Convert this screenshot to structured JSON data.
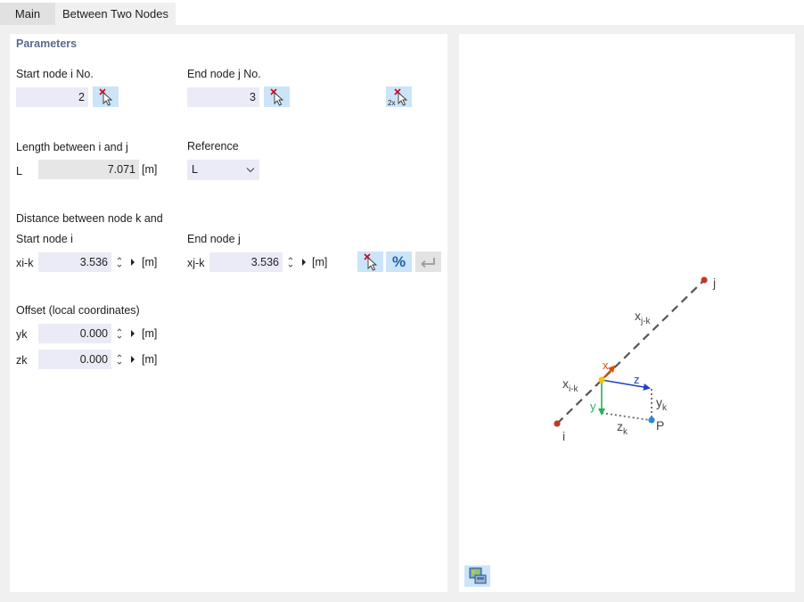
{
  "tabs": [
    {
      "label": "Main"
    },
    {
      "label": "Between Two Nodes"
    }
  ],
  "parameters": {
    "title": "Parameters",
    "start_node": {
      "label": "Start node i No.",
      "value": "2"
    },
    "end_node": {
      "label": "End node j No.",
      "value": "3"
    },
    "length": {
      "label": "Length between i and j",
      "symbol": "L",
      "value": "7.071",
      "unit": "[m]"
    },
    "reference": {
      "label": "Reference",
      "value": "L"
    },
    "distance": {
      "label": "Distance between node k and",
      "start_label": "Start node i",
      "end_label": "End node j",
      "xi_symbol": "xi-k",
      "xi_value": "3.536",
      "xj_symbol": "xj-k",
      "xj_value": "3.536",
      "unit": "[m]",
      "percent_label": "%"
    },
    "offset": {
      "label": "Offset (local coordinates)",
      "yk_symbol": "yk",
      "yk_value": "0.000",
      "zk_symbol": "zk",
      "zk_value": "0.000",
      "unit": "[m]"
    }
  },
  "diagram": {
    "labels": {
      "node_i": "i",
      "node_j": "j",
      "xjk_main": "x",
      "xjk_sub": "j-k",
      "xik_main": "x",
      "xik_sub": "i-k",
      "axis_x": "x",
      "axis_y": "y",
      "axis_z": "z",
      "yk_main": "y",
      "yk_sub": "k",
      "zk_main": "z",
      "zk_sub": "k",
      "point_p": "P"
    },
    "colors": {
      "member_line": "#555555",
      "node": "#c0392b",
      "point_k": "#f1c40f",
      "point_p": "#2e86de",
      "axis_x": "#d35400",
      "axis_y": "#27ae60",
      "axis_z": "#1f3fbf",
      "dotted": "#666666"
    }
  },
  "icons": {
    "pick": "pick-node-icon",
    "pick_two": "pick-two-nodes-icon",
    "percent": "percent-icon",
    "undo": "undo-arrow-icon",
    "export": "export-image-icon"
  }
}
